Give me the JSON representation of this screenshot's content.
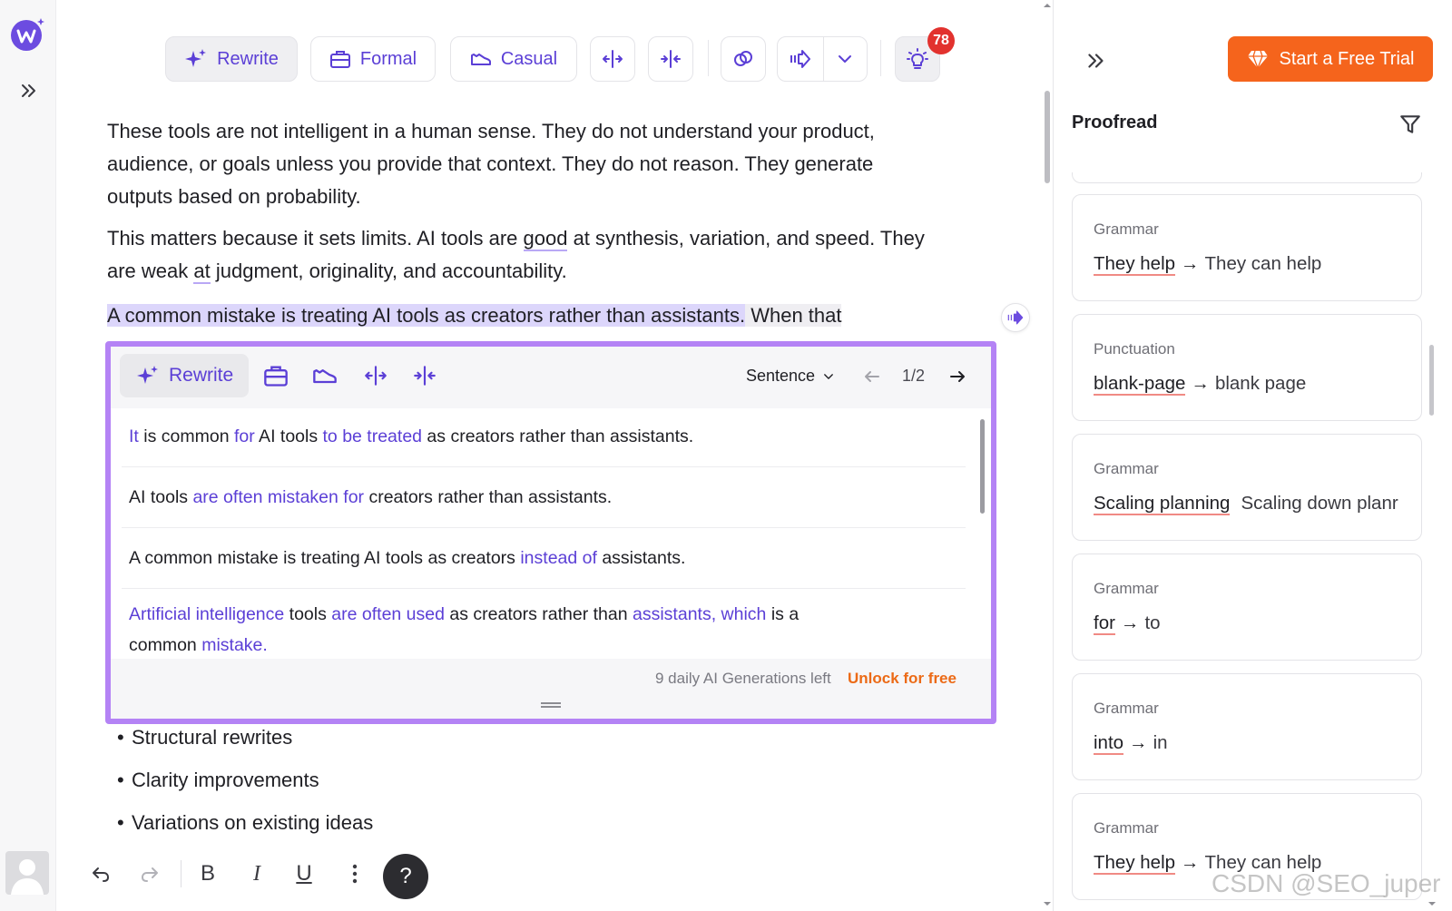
{
  "app": {
    "logo_icon": "writer-logo-icon",
    "brand_color": "#6c4ce0",
    "accent_color": "#f5641c"
  },
  "toolbar": {
    "rewrite_label": "Rewrite",
    "formal_label": "Formal",
    "casual_label": "Casual",
    "notification_count": "78"
  },
  "document": {
    "para1": "These tools are not intelligent in a human sense. They do not understand your product, audience, or goals unless you provide that context. They do not reason. They generate outputs based on probability.",
    "para2_a": "This matters because it sets limits. AI tools are ",
    "para2_good": "good",
    "para2_b": " at synthesis, variation, and speed. They are weak ",
    "para2_at": "at",
    "para2_c": " judgment, originality, and accountability.",
    "para3_highlight": "A common mistake is treating AI tools as creators rather than assistants.",
    "para3_rest": " When that",
    "bullets": [
      "Structural rewrites",
      "Clarity improvements",
      "Variations on existing ideas"
    ]
  },
  "rewrite_popup": {
    "rewrite_label": "Rewrite",
    "mode_label": "Sentence",
    "page_indicator": "1/2",
    "suggestions": [
      {
        "parts": [
          [
            "It",
            true
          ],
          [
            " is common ",
            false
          ],
          [
            "for",
            true
          ],
          [
            " AI tools ",
            false
          ],
          [
            "to be treated",
            true
          ],
          [
            " as creators rather than assistants.",
            false
          ]
        ]
      },
      {
        "parts": [
          [
            "AI tools ",
            false
          ],
          [
            "are often mistaken for",
            true
          ],
          [
            " creators rather than assistants.",
            false
          ]
        ]
      },
      {
        "parts": [
          [
            "A common mistake is treating AI tools as creators ",
            false
          ],
          [
            "instead of",
            true
          ],
          [
            " assistants.",
            false
          ]
        ]
      },
      {
        "parts": [
          [
            "Artificial intelligence",
            true
          ],
          [
            " tools ",
            false
          ],
          [
            "are often used",
            true
          ],
          [
            " as creators rather than ",
            false
          ],
          [
            "assistants, which",
            true
          ],
          [
            " is a common ",
            false
          ],
          [
            "mistake.",
            true
          ]
        ]
      }
    ],
    "footer_text": "9 daily AI Generations left",
    "unlock_label": "Unlock for free"
  },
  "format_bar": {
    "bold": "B",
    "italic": "I",
    "underline": "U",
    "help": "?"
  },
  "proofread": {
    "trial_label": "Start a Free Trial",
    "title": "Proofread",
    "cards": [
      {
        "category": "Grammar",
        "original": "They help",
        "arrow": "→",
        "suggestion": "They can help"
      },
      {
        "category": "Punctuation",
        "original": "blank-page",
        "arrow": "→",
        "suggestion": "blank page"
      },
      {
        "category": "Grammar",
        "original": "Scaling planning",
        "arrow": "",
        "suggestion": "Scaling down planr"
      },
      {
        "category": "Grammar",
        "original": "for",
        "arrow": "→",
        "suggestion": "to"
      },
      {
        "category": "Grammar",
        "original": "into",
        "arrow": "→",
        "suggestion": "in"
      },
      {
        "category": "Grammar",
        "original": "They help",
        "arrow": "→",
        "suggestion": "They can help"
      }
    ]
  },
  "watermark": "CSDN @SEO_juper"
}
